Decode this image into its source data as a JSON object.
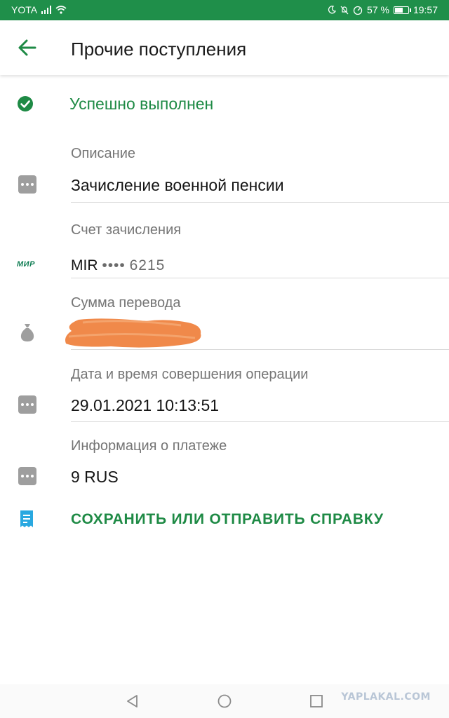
{
  "status_bar": {
    "carrier": "YOTA",
    "battery_percent": "57 %",
    "time": "19:57"
  },
  "toolbar": {
    "title": "Прочие поступления",
    "back_icon": "arrow-left-icon"
  },
  "status": {
    "text": "Успешно выполнен",
    "icon": "check-circle-icon"
  },
  "fields": [
    {
      "label": "Описание",
      "value": "Зачисление военной пенсии",
      "icon": "dots-icon"
    },
    {
      "label": "Счет зачисления",
      "value_prefix": "MIR",
      "value_mask": "••••",
      "value_suffix": "6215",
      "icon": "mir-logo",
      "icon_text": "МИР"
    },
    {
      "label": "Сумма перевода",
      "value": "",
      "icon": "money-bag-icon"
    },
    {
      "label": "Дата и время совершения операции",
      "value": "29.01.2021 10:13:51",
      "icon": "dots-icon"
    },
    {
      "label": "Информация о платеже",
      "value": "9 RUS",
      "icon": "dots-icon"
    }
  ],
  "save_action": {
    "label": "СОХРАНИТЬ ИЛИ ОТПРАВИТЬ СПРАВКУ",
    "icon": "receipt-icon"
  },
  "nav": {
    "watermark": "YAPLAKAL.COM"
  },
  "colors": {
    "status_bar": "#1f8f4a",
    "accent_green": "#1e8a45",
    "receipt_blue": "#29a8e0",
    "redaction_orange": "#f0894a"
  }
}
